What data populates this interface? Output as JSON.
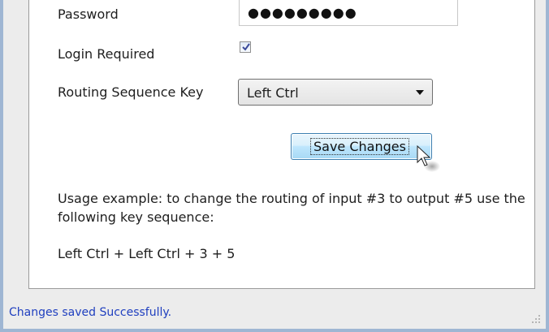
{
  "form": {
    "password_label": "Password",
    "password_value": "●●●●●●●●●",
    "login_required_label": "Login Required",
    "login_required_checked": true,
    "routing_key_label": "Routing Sequence Key",
    "routing_key_value": "Left Ctrl",
    "save_button_label": "Save Changes"
  },
  "usage": {
    "text": "Usage example: to change the routing of input #3 to output #5 use the following key sequence:",
    "example": "Left Ctrl + Left Ctrl + 3 + 5"
  },
  "status_bar": {
    "message": "Changes saved Successfully.",
    "message_color": "#1f3fbf"
  },
  "icons": {
    "checkbox_check": "checkmark-icon",
    "dropdown_arrow": "chevron-down-icon",
    "cursor": "mouse-pointer-icon",
    "resize": "resize-grip-icon"
  }
}
